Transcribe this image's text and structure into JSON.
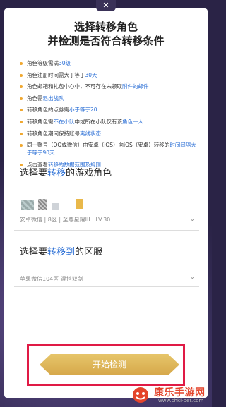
{
  "title": {
    "line1": "选择转移角色",
    "line2": "并检测是否符合转移条件"
  },
  "rules": [
    [
      {
        "t": "角色等级需满"
      },
      {
        "t": "30级",
        "h": 1
      }
    ],
    [
      {
        "t": "角色注册时间需大于等于"
      },
      {
        "t": "30天",
        "h": 1
      }
    ],
    [
      {
        "t": "角色邮箱和礼包中心中，不可存在未领取"
      },
      {
        "t": "附件的邮件",
        "h": 1
      }
    ],
    [
      {
        "t": "角色需"
      },
      {
        "t": "退出战队",
        "h": 1
      }
    ],
    [
      {
        "t": "转移角色的点券需"
      },
      {
        "t": "小于等于20",
        "h": 1
      }
    ],
    [
      {
        "t": "转移角色需"
      },
      {
        "t": "不在小队",
        "h": 1
      },
      {
        "t": "中或所在小队仅有该"
      },
      {
        "t": "角色一人",
        "h": 1
      }
    ],
    [
      {
        "t": "转移角色期间保持账号"
      },
      {
        "t": "离线状态",
        "h": 1
      }
    ],
    [
      {
        "t": "同一账号（QQ或微信）由安卓（iOS）向iOS（安卓）转移的"
      },
      {
        "t": "时间间隔大于等于90天",
        "h": 1
      }
    ],
    [
      {
        "t": "点击查看"
      },
      {
        "t": "转移的数据范围及规则",
        "h": 1
      }
    ]
  ],
  "section_role": {
    "prefix": "选择要",
    "highlight": "转移",
    "suffix": "的游戏角色"
  },
  "character_info": "安卓微信 | 8区 | 至尊星耀III | LV.30",
  "section_server": {
    "prefix": "选择要",
    "highlight": "转移到",
    "suffix": "的区服"
  },
  "server_info": "苹果微信104区 混搭双剑",
  "start_button": "开始检测",
  "watermark": {
    "name": "康乐手游网",
    "url": "www.chkl-pet.com"
  },
  "colors": {
    "highlight": "#2b6fd6",
    "button_gold": "#d6a84a",
    "frame_red": "#e01a45"
  }
}
